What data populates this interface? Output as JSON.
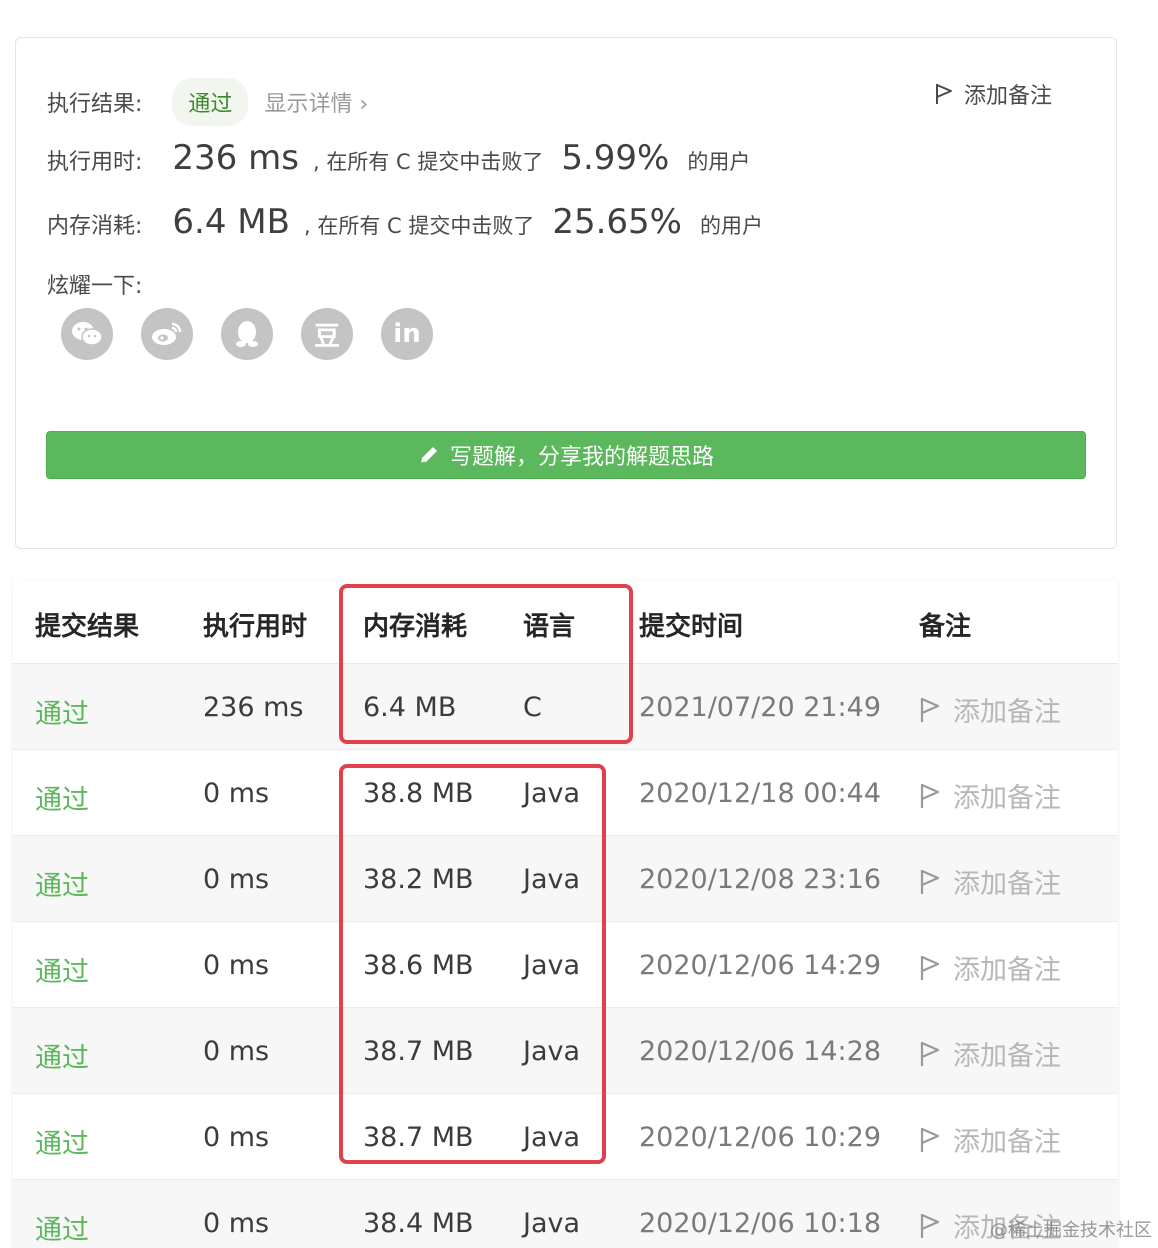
{
  "result": {
    "label": "执行结果:",
    "status": "通过",
    "details": "显示详情 ›",
    "add_note": "添加备注"
  },
  "runtime": {
    "label": "执行用时:",
    "value": "236 ms",
    "beat_text": ", 在所有 C 提交中击败了",
    "percent": "5.99%",
    "users": "的用户"
  },
  "memory": {
    "label": "内存消耗:",
    "value": "6.4 MB",
    "beat_text": ", 在所有 C 提交中击败了",
    "percent": "25.65%",
    "users": "的用户"
  },
  "share": {
    "label": "炫耀一下:",
    "icons": [
      "wechat-icon",
      "weibo-icon",
      "qq-icon",
      "douban-icon",
      "linkedin-icon"
    ],
    "douban_glyph": "豆",
    "linkedin_glyph": "in"
  },
  "solution_button": "写题解，分享我的解题思路",
  "table": {
    "headers": [
      "提交结果",
      "执行用时",
      "内存消耗",
      "语言",
      "提交时间",
      "备注"
    ],
    "rows": [
      {
        "status": "通过",
        "runtime": "236 ms",
        "memory": "6.4 MB",
        "language": "C",
        "time": "2021/07/20 21:49",
        "note": "添加备注"
      },
      {
        "status": "通过",
        "runtime": "0 ms",
        "memory": "38.8 MB",
        "language": "Java",
        "time": "2020/12/18 00:44",
        "note": "添加备注"
      },
      {
        "status": "通过",
        "runtime": "0 ms",
        "memory": "38.2 MB",
        "language": "Java",
        "time": "2020/12/08 23:16",
        "note": "添加备注"
      },
      {
        "status": "通过",
        "runtime": "0 ms",
        "memory": "38.6 MB",
        "language": "Java",
        "time": "2020/12/06 14:29",
        "note": "添加备注"
      },
      {
        "status": "通过",
        "runtime": "0 ms",
        "memory": "38.7 MB",
        "language": "Java",
        "time": "2020/12/06 14:28",
        "note": "添加备注"
      },
      {
        "status": "通过",
        "runtime": "0 ms",
        "memory": "38.7 MB",
        "language": "Java",
        "time": "2020/12/06 10:29",
        "note": "添加备注"
      },
      {
        "status": "通过",
        "runtime": "0 ms",
        "memory": "38.4 MB",
        "language": "Java",
        "time": "2020/12/06 10:18",
        "note": "添加备注"
      }
    ]
  },
  "colors": {
    "pass_green": "#5cb85c",
    "highlight_red": "#e0424d",
    "button_green": "#5cb85c"
  },
  "watermark": "@稀土掘金技术社区"
}
